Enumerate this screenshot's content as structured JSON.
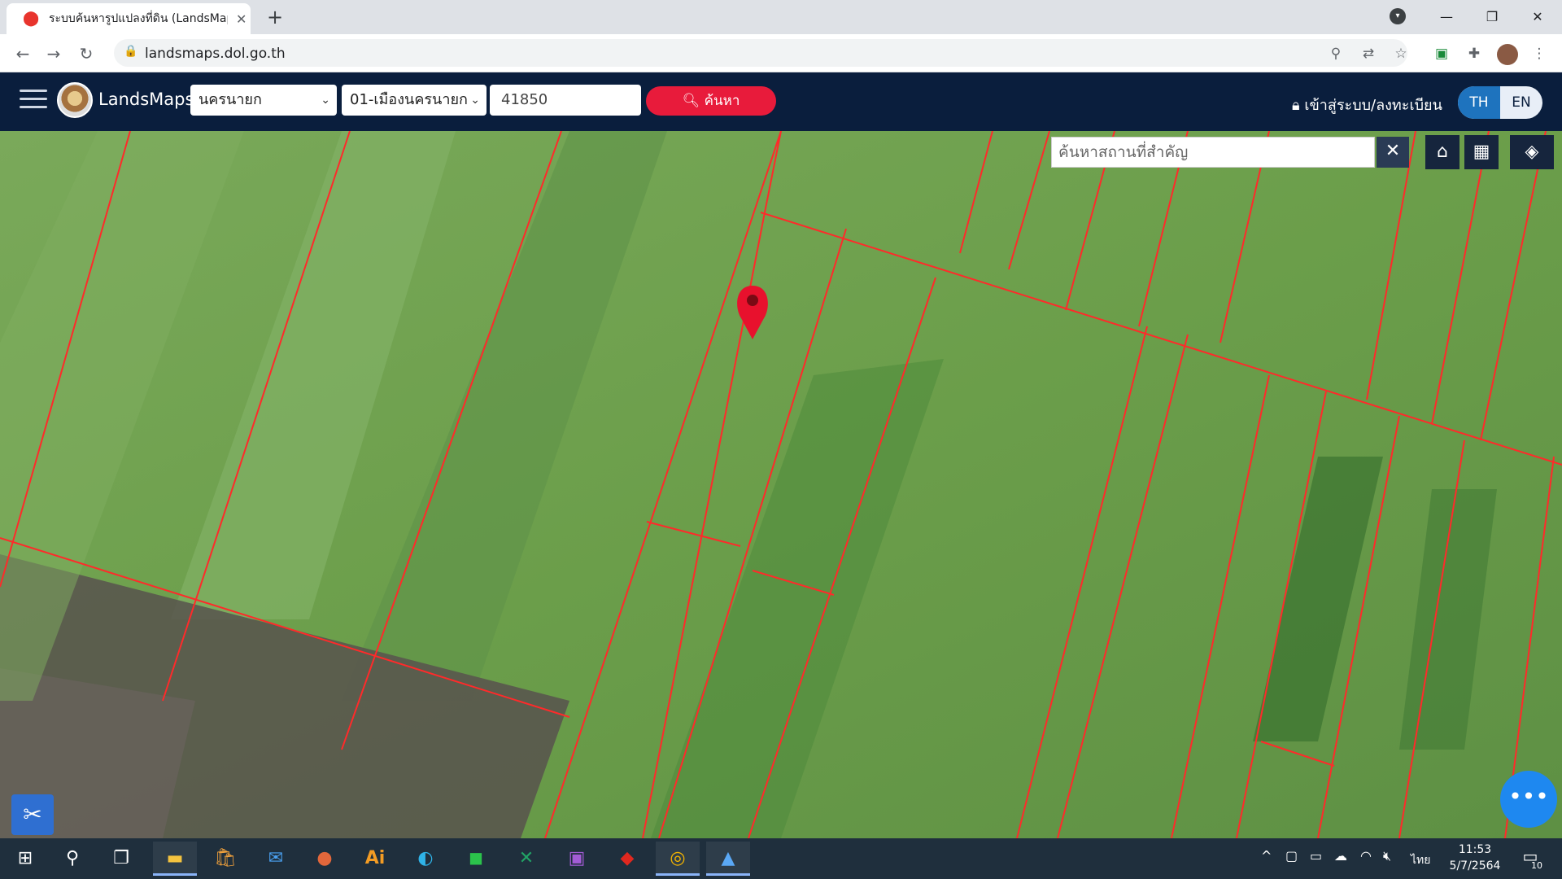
{
  "browser": {
    "tab_title": "ระบบค้นหารูปแปลงที่ดิน (LandsMaps)",
    "url": "landsmaps.dol.go.th",
    "new_tab_symbol": "+",
    "close_tab_symbol": "✕"
  },
  "app": {
    "brand": "LandsMaps",
    "province": "นครนายก",
    "district": "01-เมืองนครนายก",
    "postcode": "41850",
    "search_label": "ค้นหา",
    "login_label": "เข้าสู่ระบบ/ลงทะเบียน",
    "lang_th": "TH",
    "lang_en": "EN"
  },
  "map": {
    "place_search_placeholder": "ค้นหาสถานที่สำคัญ",
    "clear_symbol": "✕",
    "pin_color": "#e8112d",
    "parcel_line_color": "#ff2a2a"
  },
  "taskbar": {
    "time": "11:53",
    "date": "5/7/2564",
    "language": "ไทย",
    "notification_count": "10",
    "apps": [
      "start-icon",
      "search-icon",
      "task-view-icon",
      "file-explorer-icon",
      "store-icon",
      "mail-icon",
      "powerpoint-icon",
      "illustrator-icon",
      "edge-icon",
      "line-icon",
      "excel-icon",
      "onenote-icon",
      "acrobat-icon",
      "chrome-icon",
      "photos-icon"
    ],
    "ai_label": "Ai"
  }
}
